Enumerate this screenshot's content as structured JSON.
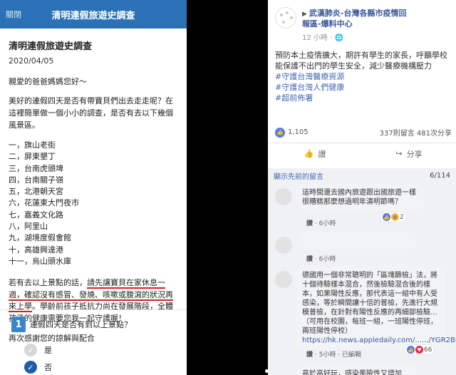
{
  "left": {
    "topbar": {
      "close_label": "關閉",
      "title": "清明連假旅遊史調查"
    },
    "form_title": "清明連假旅遊史調查",
    "form_date": "2020/04/05",
    "greeting": "親愛的爸爸媽媽您好～",
    "intro": "美好的連假四天是否有帶寶貝們出去走走呢？在這裡簡單做一個小小的調查，是否有去以下幾個風景區。",
    "places": [
      "一，旗山老街",
      "二，屏東墾丁",
      "三，台南虎頭埤",
      "四，台南關子嶺",
      "五，北港朝天宮",
      "六，花蓮東大門夜市",
      "七，嘉義文化路",
      "八，阿里山",
      "九，湖境度假會館",
      "十，高雄興達港",
      "十一，烏山頭水庫"
    ],
    "note_plain": "若有去以上景點的話，",
    "note_underlined": "請先讓寶貝在家休息一週，確認沒有感冒、發燒、咳嗽或腹瀉的狀況再來上學",
    "note_tail": "。學齡前孩子抵抗力尚在發展階段，全體孩子的健康需要您我一起守護喔！",
    "thanks": "再次感謝您的諒解與配合",
    "question": {
      "number": "1",
      "text": "連假四天是否有到以上景點？"
    },
    "options": [
      {
        "label": "是",
        "mark": "✓"
      },
      {
        "label": "否",
        "mark": "✓"
      }
    ]
  },
  "right": {
    "post": {
      "page_name_line1": "武漢肺炎-台灣各縣市疫情回",
      "page_name_line2": "報區-爆料中心",
      "meta": "12 小時 · 🌐",
      "body": "預防本土疫情擴大，期許有學生的家長，呼籲學校能保護不出門的學生安全，減少醫療機構壓力",
      "tags": [
        "#守護台灣醫療資源",
        "#守護台灣人們健康",
        "#超前佈署"
      ],
      "likes": "1,105",
      "comments_shares": "337則留言  481次分享",
      "like_label": "讚",
      "share_label": "分享"
    },
    "prev_comments": {
      "label": "顯示先前的留言",
      "count": "6/114"
    },
    "comments": [
      {
        "text": "這時間還去國內旅遊跟出國旅遊一樣很糟糕那麼想過明年清明節嗎？",
        "time": "6小時",
        "like": "讚",
        "reply": "回覆",
        "react_count": "2"
      },
      {
        "text": "",
        "time": "6小時",
        "like": "讚",
        "reply": "回覆",
        "react_count": ""
      },
      {
        "text": "德國用一個非常聰明的「區塊篩檢」法，將十個待驗樣本混合，然後檢驗混合後的樣本，如果陽性反應，那代表這一組中有人受感染，等於瞬間讓十倍的普檢，先進行大規模普檢，在針對有陽性反應的再細部檢驗...（可用在校園，每班一組，一班陽性停班，兩班陽性停校）",
        "link": "https://hk.news.appledaily.com/....../YGR2BFZC5FTPM7A....../",
        "time": "5小時",
        "like": "讚",
        "reply": "回覆",
        "edited": "已編輯",
        "react_count": "66"
      },
      {
        "text": "高於高好玩，感染風險性又增加",
        "time": "",
        "like": "",
        "reply": "",
        "react_count": ""
      }
    ]
  }
}
